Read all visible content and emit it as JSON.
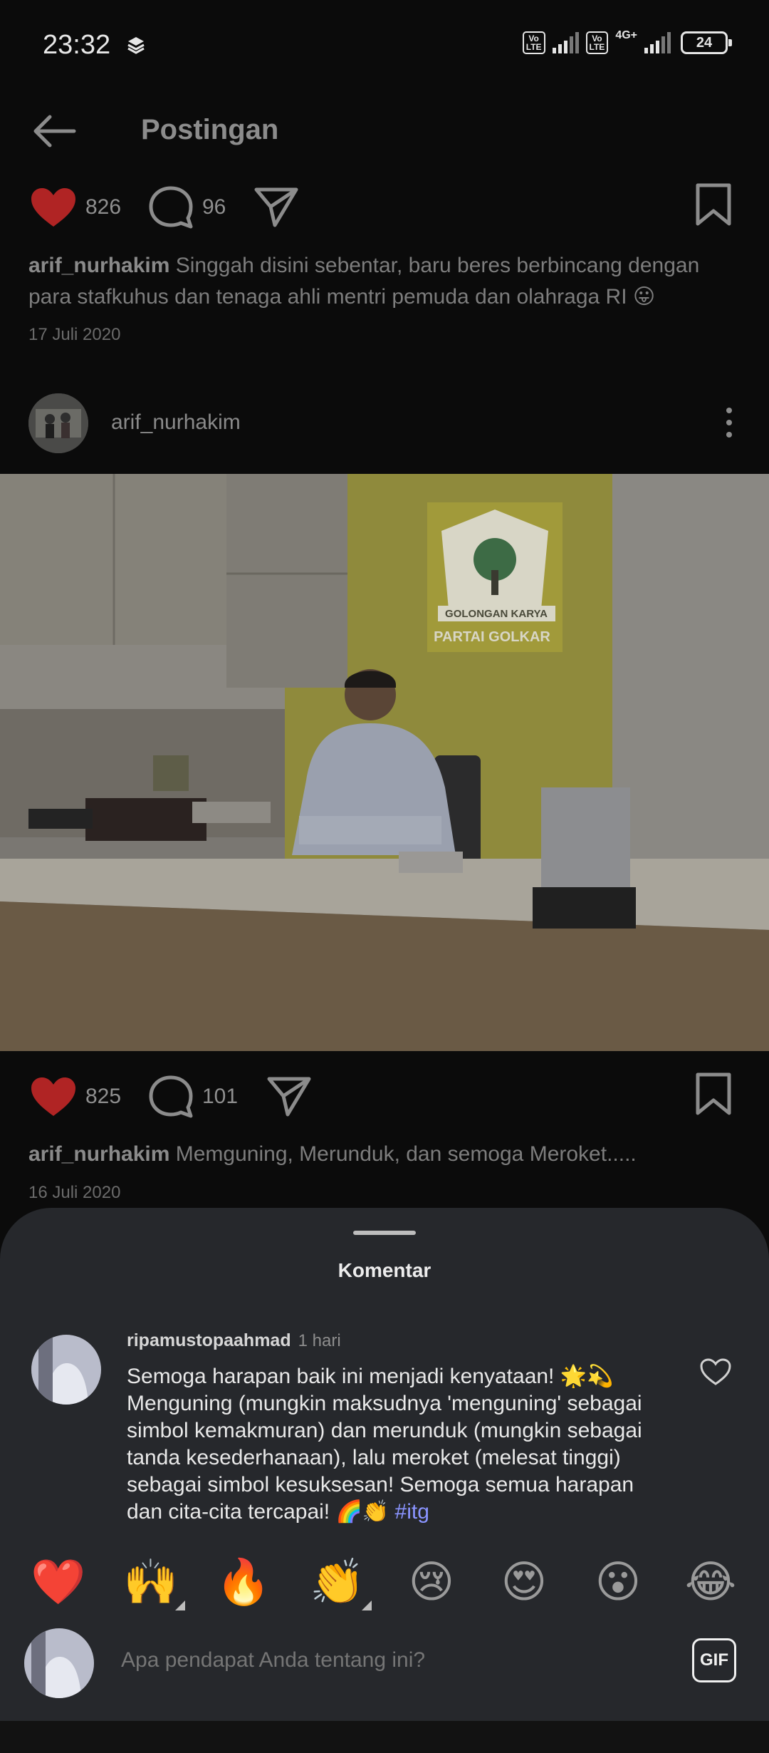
{
  "status_bar": {
    "time": "23:32",
    "volte1": "Vo\nLTE",
    "volte2": "Vo\nLTE",
    "network": "4G+",
    "battery": "24"
  },
  "header": {
    "title": "Postingan",
    "back_icon": "arrow-left-icon"
  },
  "post_prev": {
    "likes": "826",
    "comments": "96",
    "username": "arif_nurhakim",
    "caption": "Singgah disini sebentar, baru beres berbincang dengan para stafkuhus dan tenaga ahli mentri pemuda dan olahraga RI 😛",
    "date": "17 Juli 2020"
  },
  "post": {
    "username": "arif_nurhakim",
    "likes": "825",
    "comments": "101",
    "caption_user": "arif_nurhakim",
    "caption": "Memguning, Merunduk, dan semoga Meroket.....",
    "date": "16 Juli 2020",
    "photo_sign_line1": "GOLONGAN KARYA",
    "photo_sign_line2": "PARTAI GOLKAR"
  },
  "comments_sheet": {
    "title": "Komentar",
    "comment": {
      "username": "ripamustopaahmad",
      "time": "1 hari",
      "text": "Semoga harapan baik ini menjadi kenyataan! 🌟💫 Menguning (mungkin maksudnya 'menguning' sebagai simbol kemakmuran) dan merunduk (mungkin sebagai tanda kesederhanaan), lalu meroket (melesat tinggi) sebagai simbol kesuksesan! Semoga semua harapan dan cita-cita tercapai! 🌈👏",
      "hashtag": "#itg"
    },
    "reactions": [
      "❤️",
      "🙌",
      "🔥",
      "👏",
      "😢",
      "😍",
      "😮",
      "😂"
    ],
    "input_placeholder": "Apa pendapat Anda tentang ini?",
    "gif_label": "GIF"
  },
  "colors": {
    "like_red": "#c62828",
    "sheet_bg": "#26282c",
    "hashtag": "#8a94ff"
  }
}
